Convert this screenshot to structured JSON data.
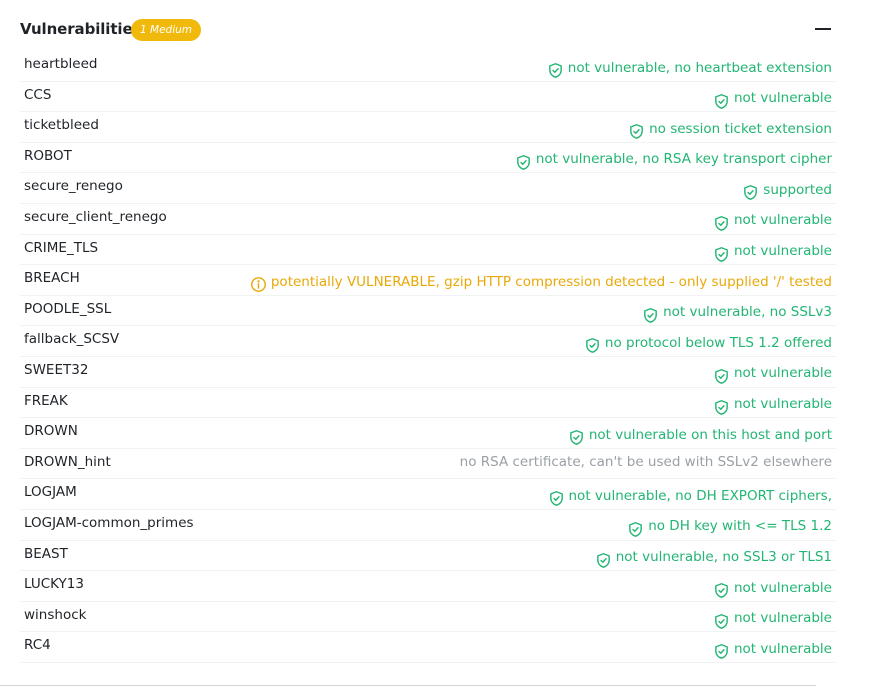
{
  "section": {
    "title": "Vulnerabilities",
    "badge": "1 Medium",
    "collapse_icon": "minus-icon"
  },
  "colors": {
    "ok": "#22b573",
    "warn": "#e8a908",
    "info": "#9aa0a6",
    "badge_bg": "#f0b90b"
  },
  "rows": [
    {
      "name": "heartbleed",
      "result": "not vulnerable, no heartbeat extension",
      "status": "ok"
    },
    {
      "name": "CCS",
      "result": "not vulnerable",
      "status": "ok"
    },
    {
      "name": "ticketbleed",
      "result": "no session ticket extension",
      "status": "ok"
    },
    {
      "name": "ROBOT",
      "result": "not vulnerable, no RSA key transport cipher",
      "status": "ok"
    },
    {
      "name": "secure_renego",
      "result": "supported",
      "status": "ok"
    },
    {
      "name": "secure_client_renego",
      "result": "not vulnerable",
      "status": "ok"
    },
    {
      "name": "CRIME_TLS",
      "result": "not vulnerable",
      "status": "ok"
    },
    {
      "name": "BREACH",
      "result": "potentially VULNERABLE, gzip HTTP compression detected - only supplied '/' tested",
      "status": "warn"
    },
    {
      "name": "POODLE_SSL",
      "result": "not vulnerable, no SSLv3",
      "status": "ok"
    },
    {
      "name": "fallback_SCSV",
      "result": "no protocol below TLS 1.2 offered",
      "status": "ok"
    },
    {
      "name": "SWEET32",
      "result": "not vulnerable",
      "status": "ok"
    },
    {
      "name": "FREAK",
      "result": "not vulnerable",
      "status": "ok"
    },
    {
      "name": "DROWN",
      "result": "not vulnerable on this host and port",
      "status": "ok"
    },
    {
      "name": "DROWN_hint",
      "result": "no RSA certificate, can't be used with SSLv2 elsewhere",
      "status": "info"
    },
    {
      "name": "LOGJAM",
      "result": "not vulnerable, no DH EXPORT ciphers,",
      "status": "ok"
    },
    {
      "name": "LOGJAM-common_primes",
      "result": "no DH key with <= TLS 1.2",
      "status": "ok"
    },
    {
      "name": "BEAST",
      "result": "not vulnerable, no SSL3 or TLS1",
      "status": "ok"
    },
    {
      "name": "LUCKY13",
      "result": "not vulnerable",
      "status": "ok"
    },
    {
      "name": "winshock",
      "result": "not vulnerable",
      "status": "ok"
    },
    {
      "name": "RC4",
      "result": "not vulnerable",
      "status": "ok"
    }
  ]
}
